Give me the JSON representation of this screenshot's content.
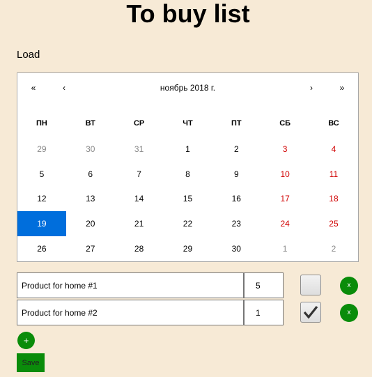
{
  "title": "To buy list",
  "load_label": "Load",
  "calendar": {
    "prev2": "«",
    "prev": "‹",
    "month": "ноябрь 2018 г.",
    "next": "›",
    "next2": "»",
    "weekdays": [
      "ПН",
      "ВТ",
      "СР",
      "ЧТ",
      "ПТ",
      "СБ",
      "ВС"
    ],
    "days": [
      {
        "label": "29",
        "other": true,
        "weekend": false,
        "selected": false
      },
      {
        "label": "30",
        "other": true,
        "weekend": false,
        "selected": false
      },
      {
        "label": "31",
        "other": true,
        "weekend": false,
        "selected": false
      },
      {
        "label": "1",
        "other": false,
        "weekend": false,
        "selected": false
      },
      {
        "label": "2",
        "other": false,
        "weekend": false,
        "selected": false
      },
      {
        "label": "3",
        "other": false,
        "weekend": true,
        "selected": false
      },
      {
        "label": "4",
        "other": false,
        "weekend": true,
        "selected": false
      },
      {
        "label": "5",
        "other": false,
        "weekend": false,
        "selected": false
      },
      {
        "label": "6",
        "other": false,
        "weekend": false,
        "selected": false
      },
      {
        "label": "7",
        "other": false,
        "weekend": false,
        "selected": false
      },
      {
        "label": "8",
        "other": false,
        "weekend": false,
        "selected": false
      },
      {
        "label": "9",
        "other": false,
        "weekend": false,
        "selected": false
      },
      {
        "label": "10",
        "other": false,
        "weekend": true,
        "selected": false
      },
      {
        "label": "11",
        "other": false,
        "weekend": true,
        "selected": false
      },
      {
        "label": "12",
        "other": false,
        "weekend": false,
        "selected": false
      },
      {
        "label": "13",
        "other": false,
        "weekend": false,
        "selected": false
      },
      {
        "label": "14",
        "other": false,
        "weekend": false,
        "selected": false
      },
      {
        "label": "15",
        "other": false,
        "weekend": false,
        "selected": false
      },
      {
        "label": "16",
        "other": false,
        "weekend": false,
        "selected": false
      },
      {
        "label": "17",
        "other": false,
        "weekend": true,
        "selected": false
      },
      {
        "label": "18",
        "other": false,
        "weekend": true,
        "selected": false
      },
      {
        "label": "19",
        "other": false,
        "weekend": false,
        "selected": true
      },
      {
        "label": "20",
        "other": false,
        "weekend": false,
        "selected": false
      },
      {
        "label": "21",
        "other": false,
        "weekend": false,
        "selected": false
      },
      {
        "label": "22",
        "other": false,
        "weekend": false,
        "selected": false
      },
      {
        "label": "23",
        "other": false,
        "weekend": false,
        "selected": false
      },
      {
        "label": "24",
        "other": false,
        "weekend": true,
        "selected": false
      },
      {
        "label": "25",
        "other": false,
        "weekend": true,
        "selected": false
      },
      {
        "label": "26",
        "other": false,
        "weekend": false,
        "selected": false
      },
      {
        "label": "27",
        "other": false,
        "weekend": false,
        "selected": false
      },
      {
        "label": "28",
        "other": false,
        "weekend": false,
        "selected": false
      },
      {
        "label": "29",
        "other": false,
        "weekend": false,
        "selected": false
      },
      {
        "label": "30",
        "other": false,
        "weekend": false,
        "selected": false
      },
      {
        "label": "1",
        "other": true,
        "weekend": true,
        "selected": false
      },
      {
        "label": "2",
        "other": true,
        "weekend": true,
        "selected": false
      }
    ]
  },
  "items": [
    {
      "name": "Product for home #1",
      "quantity": "5",
      "checked": false,
      "delete_label": "x"
    },
    {
      "name": "Product for home #2",
      "quantity": "1",
      "checked": true,
      "delete_label": "x"
    }
  ],
  "add_label": "+",
  "save_label": "Save",
  "colors": {
    "background": "#f7ead6",
    "accent_green": "#0a8c0a",
    "selected_day": "#006edc",
    "weekend_red": "#d10000"
  }
}
